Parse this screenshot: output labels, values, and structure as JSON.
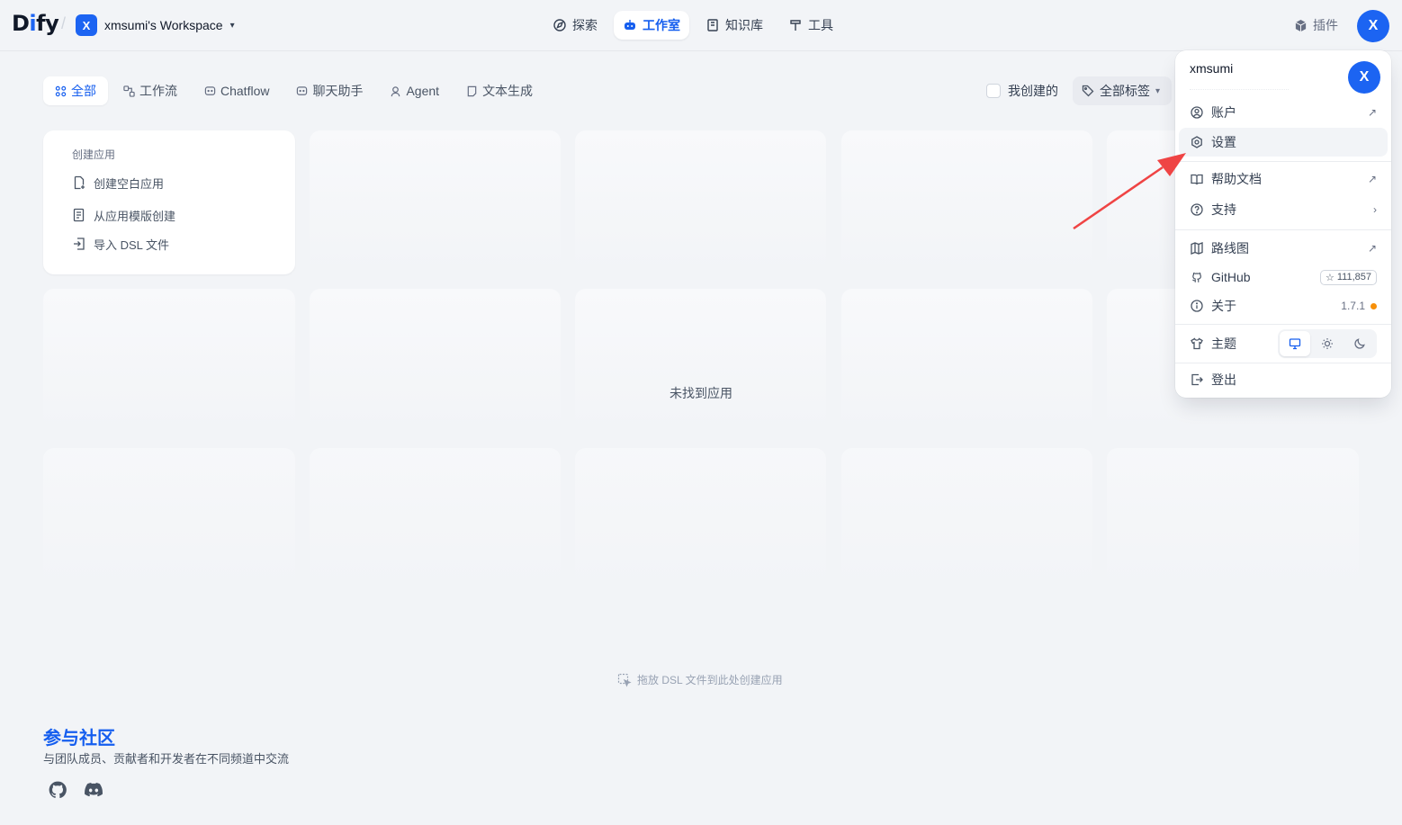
{
  "header": {
    "logo": "Dify",
    "workspace_initial": "X",
    "workspace_name": "xmsumi's Workspace",
    "nav": [
      {
        "label": "探索"
      },
      {
        "label": "工作室"
      },
      {
        "label": "知识库"
      },
      {
        "label": "工具"
      }
    ],
    "plugins_label": "插件",
    "user_initial": "X"
  },
  "filters": {
    "tabs": [
      {
        "label": "全部"
      },
      {
        "label": "工作流"
      },
      {
        "label": "Chatflow"
      },
      {
        "label": "聊天助手"
      },
      {
        "label": "Agent"
      },
      {
        "label": "文本生成"
      }
    ],
    "mine_label": "我创建的",
    "tags_label": "全部标签"
  },
  "create_card": {
    "title": "创建应用",
    "items": [
      {
        "label": "创建空白应用"
      },
      {
        "label": "从应用模版创建"
      },
      {
        "label": "导入 DSL 文件"
      }
    ]
  },
  "empty_text": "未找到应用",
  "drop_hint": "拖放 DSL 文件到此处创建应用",
  "community": {
    "title": "参与社区",
    "subtitle": "与团队成员、贡献者和开发者在不同频道中交流"
  },
  "menu": {
    "username": "xmsumi",
    "avatar_initial": "X",
    "items": [
      {
        "label": "账户"
      },
      {
        "label": "设置"
      },
      {
        "label": "帮助文档"
      },
      {
        "label": "支持"
      },
      {
        "label": "路线图"
      },
      {
        "label": "GitHub",
        "stars": "111,857"
      },
      {
        "label": "关于",
        "version": "1.7.1"
      },
      {
        "label": "主题"
      },
      {
        "label": "登出"
      }
    ]
  },
  "colors": {
    "accent": "#155eef",
    "annotation_arrow": "#ef4444",
    "update_dot": "#f79009"
  }
}
